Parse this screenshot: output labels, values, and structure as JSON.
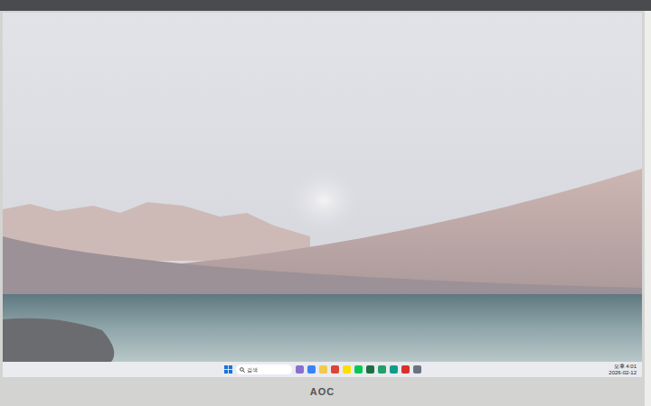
{
  "monitor": {
    "brand": "AOC"
  },
  "taskbar": {
    "search": {
      "placeholder": "검색"
    },
    "apps": [
      {
        "color": "#8a6fd1"
      },
      {
        "color": "#3b82f6"
      },
      {
        "color": "#f2c94c"
      },
      {
        "color": "#db4437"
      },
      {
        "color": "#f9e000"
      },
      {
        "color": "#06c755"
      },
      {
        "color": "#1d6f42"
      },
      {
        "color": "#22a06b"
      },
      {
        "color": "#0f9d8a"
      },
      {
        "color": "#d9302c"
      },
      {
        "color": "#6b7280"
      }
    ],
    "clock": {
      "time": "오후 4:01",
      "date": "2026-02-12"
    }
  }
}
